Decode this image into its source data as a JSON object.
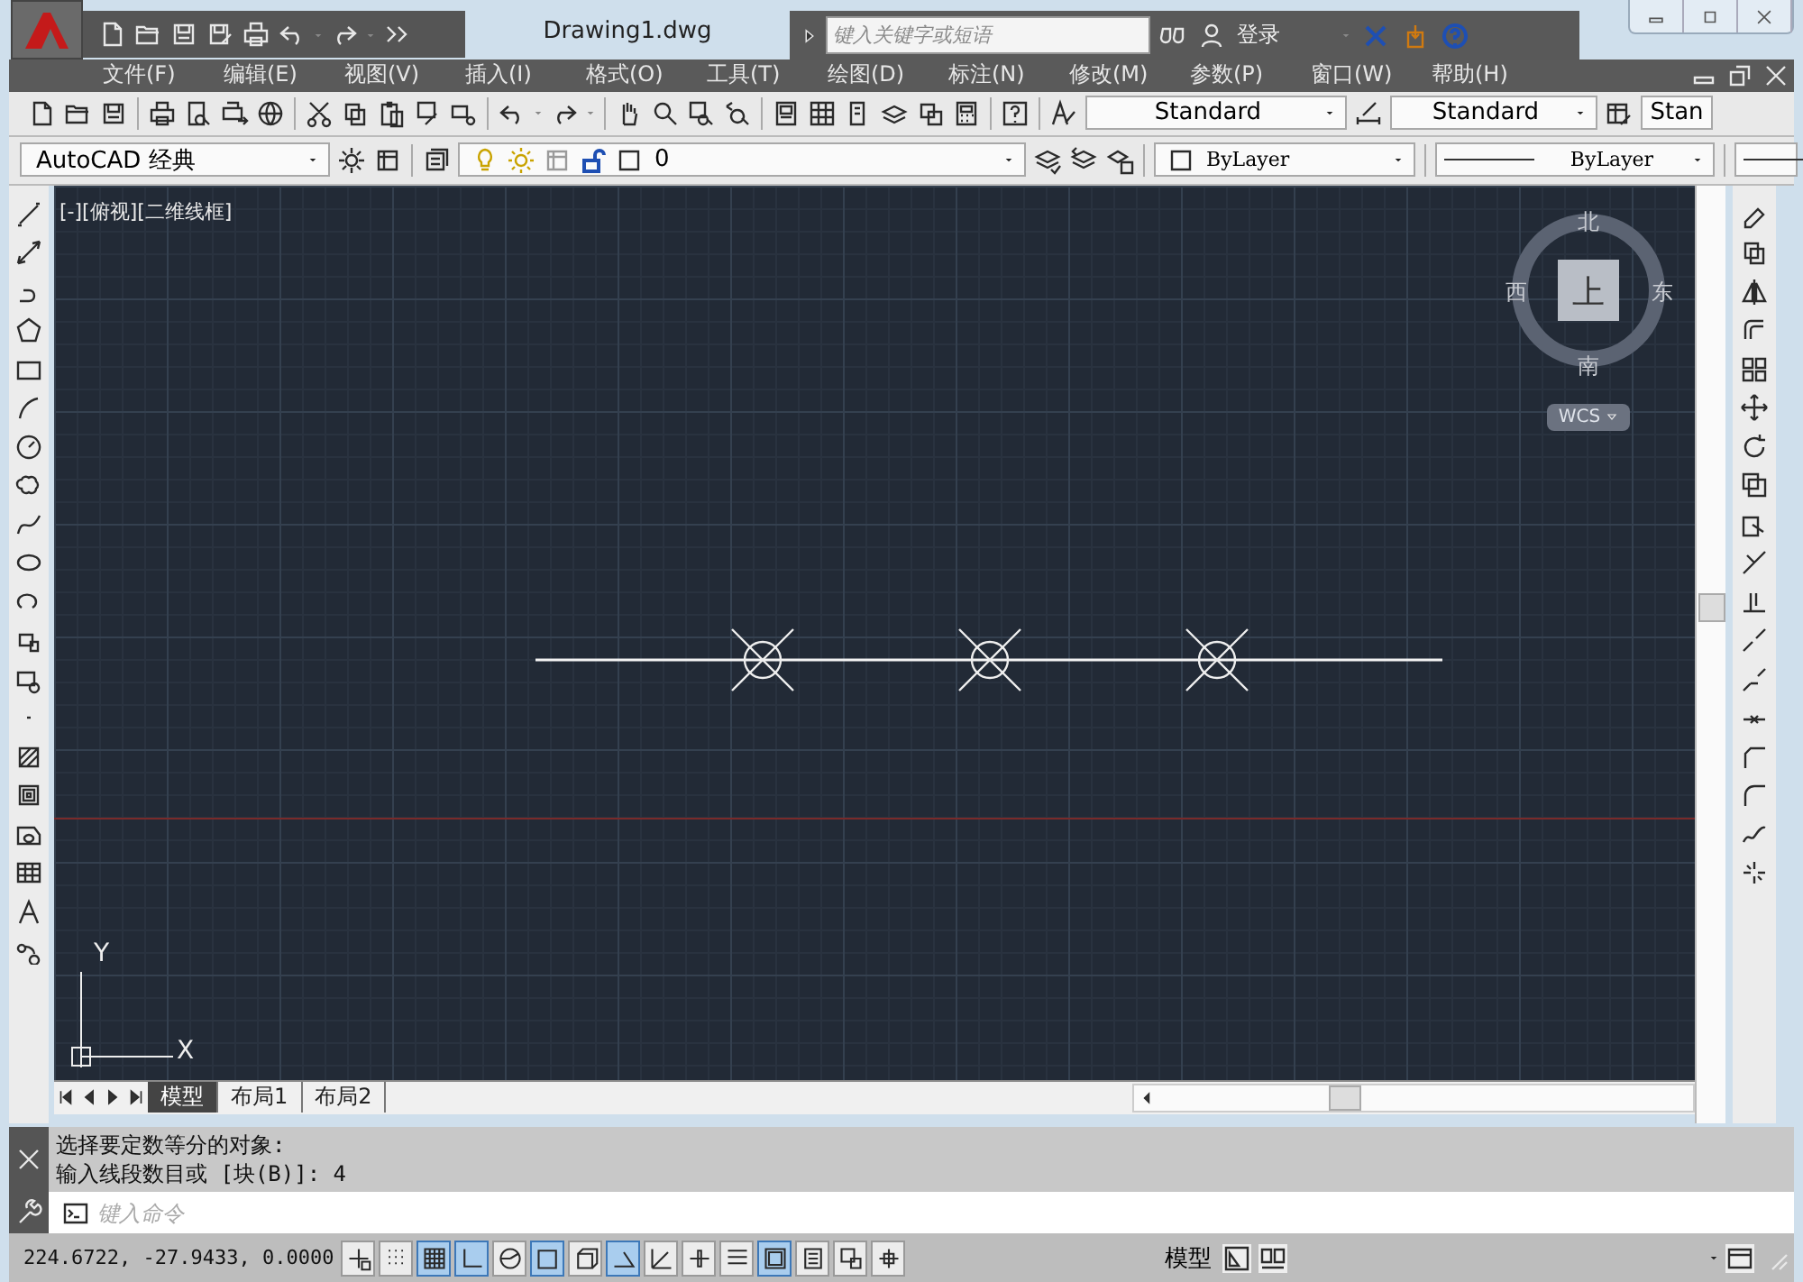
{
  "title_bar": {
    "document_title": "Drawing1.dwg",
    "search": {
      "placeholder": "键入关键字或短语"
    },
    "sign_in": "登录"
  },
  "menu_bar": {
    "items": [
      "文件(F)",
      "编辑(E)",
      "视图(V)",
      "插入(I)",
      "格式(O)",
      "工具(T)",
      "绘图(D)",
      "标注(N)",
      "修改(M)",
      "参数(P)",
      "窗口(W)",
      "帮助(H)"
    ]
  },
  "styles_toolbar": {
    "text_style": "Standard",
    "dim_style": "Standard",
    "table_style": "Stan"
  },
  "properties_bar": {
    "workspace": "AutoCAD 经典",
    "layer": "0",
    "color_setting": "ByLayer",
    "linetype": "ByLayer"
  },
  "viewport": {
    "label": "[-][俯视][二维线框]",
    "viewcube": {
      "north": "北",
      "south": "南",
      "east": "东",
      "west": "西",
      "face": "上",
      "ucs_menu": "WCS"
    },
    "ucs": {
      "x": "X",
      "y": "Y"
    }
  },
  "layout_tabs": [
    {
      "label": "模型",
      "selected": true
    },
    {
      "label": "布局1",
      "selected": false
    },
    {
      "label": "布局2",
      "selected": false
    }
  ],
  "command_history": [
    "选择要定数等分的对象:",
    "输入线段数目或 [块(B)]: 4"
  ],
  "command_line": {
    "placeholder": "键入命令"
  },
  "status_bar": {
    "coordinates": "224.6722, -27.9433, 0.0000",
    "toggles": [
      {
        "kind": "infer",
        "on": false
      },
      {
        "kind": "snap",
        "on": false
      },
      {
        "kind": "grid",
        "on": true
      },
      {
        "kind": "ortho",
        "on": true
      },
      {
        "kind": "polar",
        "on": false
      },
      {
        "kind": "osnap",
        "on": true
      },
      {
        "kind": "osnap3d",
        "on": false
      },
      {
        "kind": "otrack",
        "on": true
      },
      {
        "kind": "ducs",
        "on": false
      },
      {
        "kind": "dyn",
        "on": false
      },
      {
        "kind": "lwt",
        "on": false
      },
      {
        "kind": "transparency",
        "on": true
      },
      {
        "kind": "quickprops",
        "on": false
      },
      {
        "kind": "selcycle",
        "on": false
      },
      {
        "kind": "annomon",
        "on": false
      }
    ],
    "space": "模型"
  }
}
